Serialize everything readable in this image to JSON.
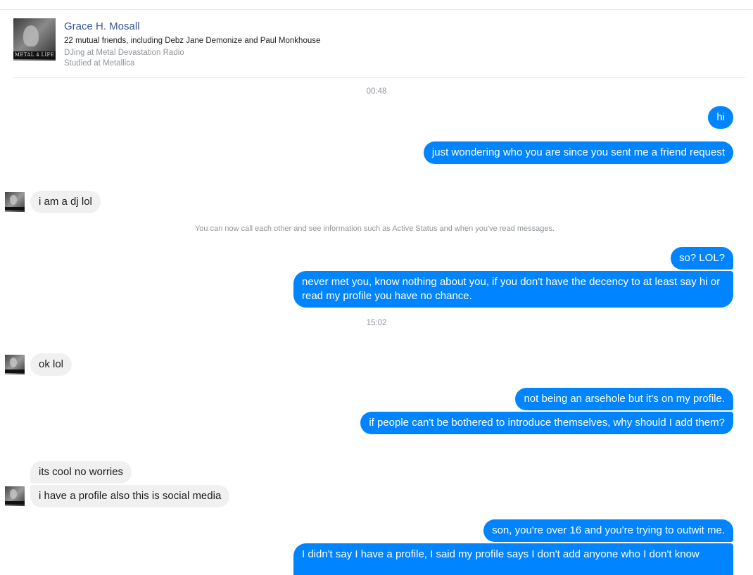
{
  "profile": {
    "name": "Grace H. Mosall",
    "mutual_friends": "22 mutual friends, including Debz Jane Demonize and Paul Monkhouse",
    "work": "DJing at Metal Devastation Radio",
    "education": "Studied at Metallica",
    "avatar_logo_text": "METAL 4 LIFE"
  },
  "conversation": {
    "timestamp_1": "00:48",
    "notice": "You can now call each other and see information such as Active Status and when you've read messages.",
    "timestamp_2": "15:02",
    "messages": [
      {
        "from": "me",
        "text": "hi"
      },
      {
        "from": "me",
        "text": "just wondering who you are since you sent me a friend request"
      },
      {
        "from": "them",
        "text": "i am a dj  lol"
      },
      {
        "from": "me",
        "text": "so? LOL?"
      },
      {
        "from": "me",
        "text": "never met you, know nothing about you, if you don't have the decency to at least say hi or read my profile you have no chance."
      },
      {
        "from": "them",
        "text": "ok lol"
      },
      {
        "from": "me",
        "text": "not being an arsehole but it's on my profile."
      },
      {
        "from": "me",
        "text": "if people can't be bothered to introduce themselves, why should I add them?"
      },
      {
        "from": "them",
        "text": "its cool no worries"
      },
      {
        "from": "them",
        "text": "i have a profile also this is social media"
      },
      {
        "from": "me",
        "text": "son, you're over 16 and you're trying to outwit me."
      },
      {
        "from": "me",
        "text": "I didn't say I have a profile, I said my profile says I don't add anyone who I don't know"
      }
    ]
  },
  "colors": {
    "outgoing_bubble": "#0084ff",
    "incoming_bubble": "#f1f0f0",
    "name_link": "#385898",
    "muted_text": "#90949c"
  }
}
